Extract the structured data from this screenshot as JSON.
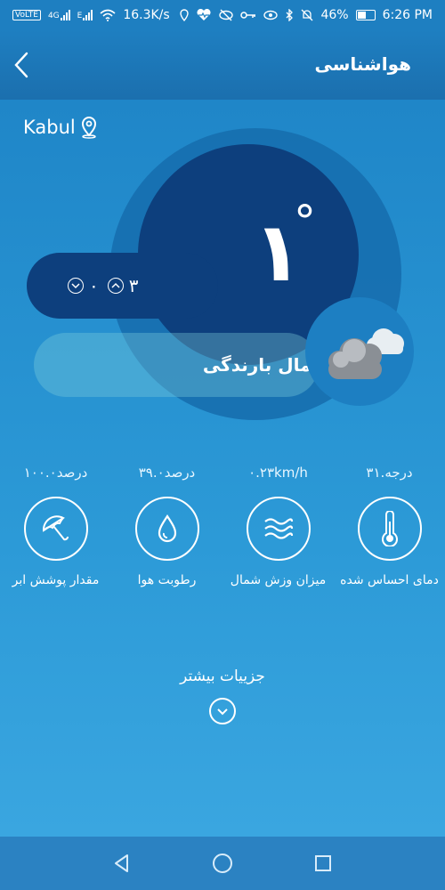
{
  "status": {
    "net_speed": "16.3K/s",
    "battery": "46%",
    "time": "6:26 PM",
    "volte": "VoLTE",
    "sig1": "4G",
    "sig2": "E"
  },
  "header": {
    "title": "هواشناسی"
  },
  "location": {
    "city": "Kabul"
  },
  "weather": {
    "temperature": "۱",
    "degree_symbol": "°",
    "min": "۰",
    "max": "۳",
    "rain_chance_label": "احتمال بارندگی"
  },
  "stats": [
    {
      "value": "۳۱.درجه",
      "label": "دمای احساس شده",
      "icon": "thermometer-icon"
    },
    {
      "value": "۰.۲۳km/h",
      "label": "میزان وزش شمال",
      "icon": "wind-icon"
    },
    {
      "value": "۳۹.۰درصد",
      "label": "رطوبت هوا",
      "icon": "water-drop-icon"
    },
    {
      "value": "۱۰۰.۰درصد",
      "label": "مقدار پوشش ابر",
      "icon": "umbrella-icon"
    }
  ],
  "more": {
    "label": "جزییات بیشتر"
  }
}
